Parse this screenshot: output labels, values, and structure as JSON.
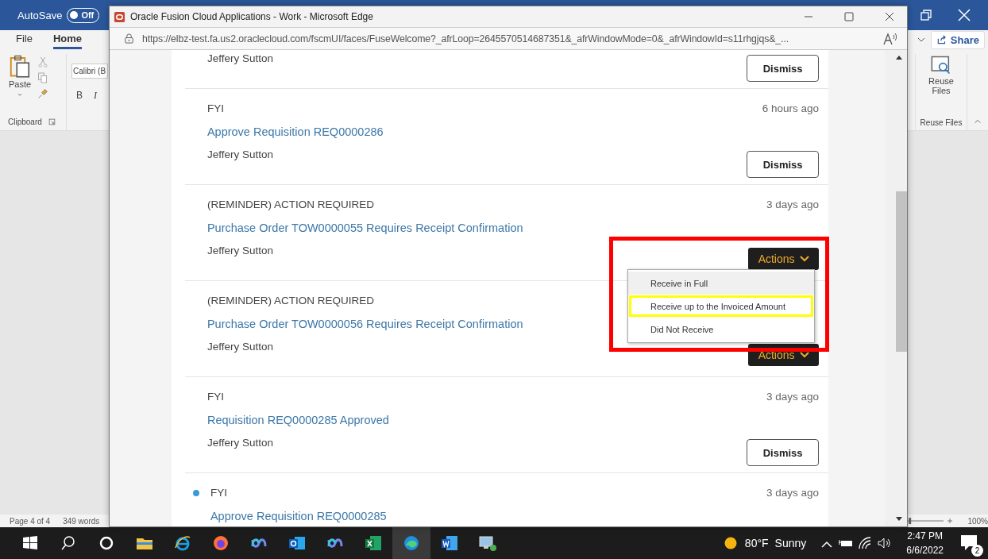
{
  "word": {
    "autosave": {
      "label": "AutoSave",
      "toggle": "Off",
      "on": false
    },
    "tabs": [
      {
        "label": "File",
        "selected": false
      },
      {
        "label": "Home",
        "selected": true
      }
    ],
    "paste": "Paste",
    "font_box": "Calibri (B",
    "format_buttons": [
      "B",
      "I"
    ],
    "group_label": "Clipboard",
    "share": "Share",
    "reuse": {
      "label": "Reuse Files",
      "group": "Reuse Files"
    },
    "status_bar": {
      "page": "Page 4 of 4",
      "words": "349 words",
      "zoom": "100%",
      "zoom_slider": {
        "level": 0.05
      }
    }
  },
  "browser": {
    "title": "Oracle Fusion Cloud Applications - Work - Microsoft Edge",
    "url": "https://elbz-test.fa.us2.oraclecloud.com/fscmUI/faces/FuseWelcome?_afrLoop=2645570514687351&_afrWindowMode=0&_afrWindowId=s11rhgjqs&_...",
    "notifications": [
      {
        "from": "Jeffery Sutton",
        "action": {
          "kind": "dismiss",
          "label": "Dismiss"
        },
        "unread": false
      },
      {
        "type": "FYI",
        "time": "6 hours ago",
        "title": "Approve Requisition REQ0000286",
        "from": "Jeffery Sutton",
        "action": {
          "kind": "dismiss",
          "label": "Dismiss"
        },
        "unread": false
      },
      {
        "type": "(REMINDER) ACTION REQUIRED",
        "time": "3 days ago",
        "title": "Purchase Order TOW0000055 Requires Receipt Confirmation",
        "from": "Jeffery Sutton",
        "action": {
          "kind": "actions",
          "label": "Actions"
        },
        "unread": false
      },
      {
        "type": "(REMINDER) ACTION REQUIRED",
        "title": "Purchase Order TOW0000056 Requires Receipt Confirmation",
        "from": "Jeffery Sutton",
        "action": {
          "kind": "actions",
          "label": "Actions"
        },
        "unread": false
      },
      {
        "type": "FYI",
        "time": "3 days ago",
        "title": "Requisition REQ0000285 Approved",
        "from": "Jeffery Sutton",
        "action": {
          "kind": "dismiss",
          "label": "Dismiss"
        },
        "unread": false
      },
      {
        "type": "FYI",
        "time": "3 days ago",
        "title": "Approve Requisition REQ0000285",
        "unread": true
      }
    ],
    "menu": {
      "items": [
        {
          "label": "Receive in Full",
          "selected": true,
          "highlighted": false
        },
        {
          "label": "Receive up to the Invoiced Amount",
          "selected": false,
          "highlighted": true
        },
        {
          "label": "Did Not Receive",
          "selected": false,
          "highlighted": false
        }
      ]
    }
  },
  "taskbar": {
    "weather": {
      "temp": "80°F",
      "condition": "Sunny"
    },
    "time": "2:47 PM",
    "date": "6/6/2022",
    "notification_count": "2"
  }
}
